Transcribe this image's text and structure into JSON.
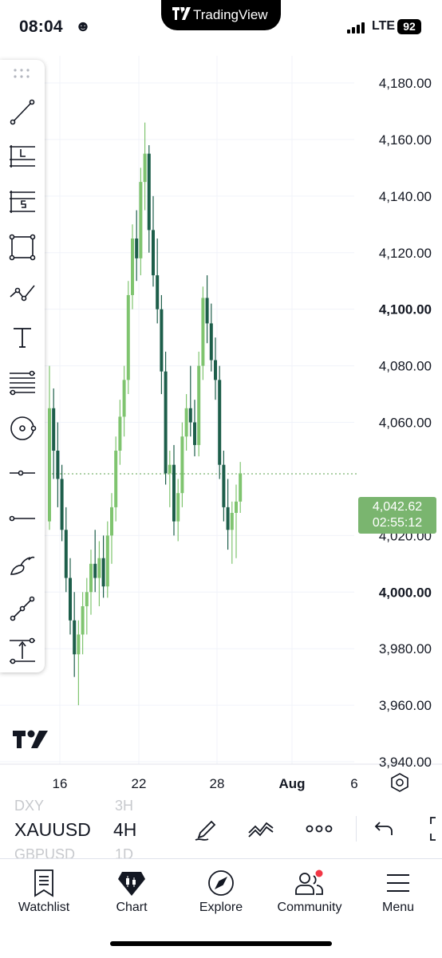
{
  "status_bar": {
    "time": "08:04",
    "time_emoji": "☻",
    "app_name": "TradingView",
    "network": "LTE",
    "battery": "92"
  },
  "chart": {
    "price_labels": [
      "4,180.00",
      "4,160.00",
      "4,140.00",
      "4,120.00",
      "4,100.00",
      "4,080.00",
      "4,060.00",
      "4,020.00",
      "4,000.00",
      "3,980.00",
      "3,960.00",
      "3,940.00"
    ],
    "bold_labels": [
      "4,100.00",
      "4,000.00"
    ],
    "date_labels": [
      "16",
      "22",
      "28",
      "Aug",
      "6"
    ],
    "last_price": "4,042.62",
    "countdown": "02:55:12",
    "up_color": "#7fc46f",
    "down_color": "#1d5e4a"
  },
  "toolbar": {
    "tools": [
      "trend-line",
      "long-position",
      "short-position",
      "rectangle",
      "path",
      "text",
      "fib-retracement",
      "circle-target",
      "horizontal-ray",
      "horizontal-line",
      "brush",
      "measure-line",
      "measure-price"
    ]
  },
  "symbol_bar": {
    "prev_symbol": "DXY",
    "symbol": "XAUUSD",
    "next_symbol": "GBPUSD",
    "prev_interval": "3H",
    "interval": "4H",
    "next_interval": "1D"
  },
  "nav": {
    "watchlist": "Watchlist",
    "chart": "Chart",
    "explore": "Explore",
    "community": "Community",
    "menu": "Menu"
  }
}
